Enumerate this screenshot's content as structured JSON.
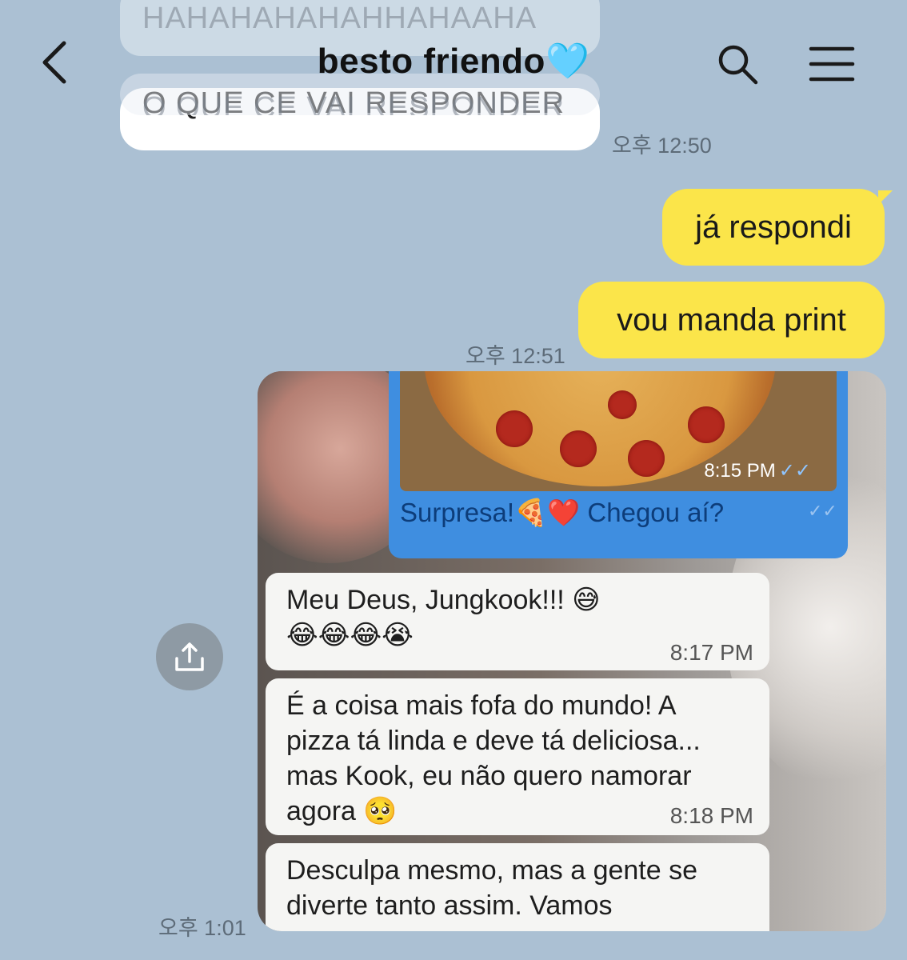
{
  "header": {
    "title": "besto friendo",
    "title_emoji": "🩵",
    "back_icon": "chevron-left-icon",
    "search_icon": "search-icon",
    "menu_icon": "hamburger-menu-icon"
  },
  "messages": {
    "ghost_1": "HAHAHAHAHAHHAHAAHA",
    "ghost_2": "O QUE CE VAI RESPONDER",
    "incoming_text": "O QUE CE VAI RESPONDER",
    "incoming_time": "오후 12:50",
    "outgoing_1": "já respondi",
    "outgoing_2": "vou manda print",
    "outgoing_time": "오후 12:51",
    "image_time": "오후 1:01"
  },
  "screenshot": {
    "pizza_time": "8:15 PM",
    "pizza_ticks": "✓✓",
    "caption": "Surpresa!🍕❤️ Chegou aí?",
    "caption_ticks": "✓✓",
    "msg1_line1": "Meu Deus, Jungkook!!! 😅",
    "msg1_line2": "😂😂😂😭",
    "msg1_time": "8:17 PM",
    "msg2_line1": "É a coisa mais fofa do mundo! A",
    "msg2_line2": "pizza tá linda e deve tá deliciosa...",
    "msg2_line3": "mas Kook, eu não quero namorar",
    "msg2_line4": "agora 🥺",
    "msg2_time": "8:18 PM",
    "msg3_line1": "Desculpa mesmo, mas a gente se",
    "msg3_line2": "diverte tanto assim. Vamos"
  },
  "share_icon": "share-upload-icon",
  "colors": {
    "background": "#abc0d3",
    "outgoing_bubble": "#fbe54a",
    "incoming_bubble": "#ffffff",
    "share_button": "#8e9aa4"
  }
}
